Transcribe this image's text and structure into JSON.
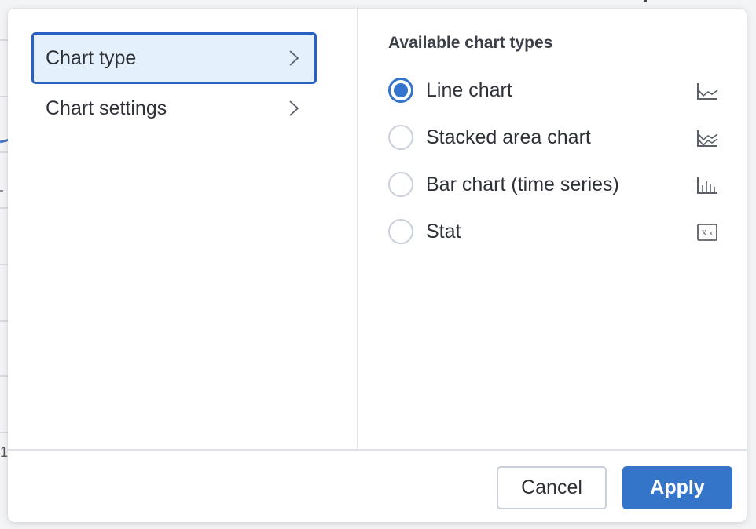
{
  "background": {
    "partial_label": "1"
  },
  "dialog": {
    "nav": {
      "items": [
        {
          "label": "Chart type",
          "selected": true,
          "icon": "chevron-right-icon"
        },
        {
          "label": "Chart settings",
          "selected": false,
          "icon": "chevron-right-icon"
        }
      ]
    },
    "chart_types": {
      "title": "Available chart types",
      "options": [
        {
          "label": "Line chart",
          "checked": true,
          "icon": "line-chart-icon"
        },
        {
          "label": "Stacked area chart",
          "checked": false,
          "icon": "stacked-area-chart-icon"
        },
        {
          "label": "Bar chart (time series)",
          "checked": false,
          "icon": "bar-chart-icon"
        },
        {
          "label": "Stat",
          "checked": false,
          "icon": "stat-icon",
          "icon_text": "X.x"
        }
      ]
    },
    "footer": {
      "cancel_label": "Cancel",
      "apply_label": "Apply"
    },
    "colors": {
      "accent": "#3575c9",
      "selected_nav_bg": "#e4f0fb",
      "selected_nav_border": "#2961c3",
      "text": "#2e3138"
    }
  }
}
